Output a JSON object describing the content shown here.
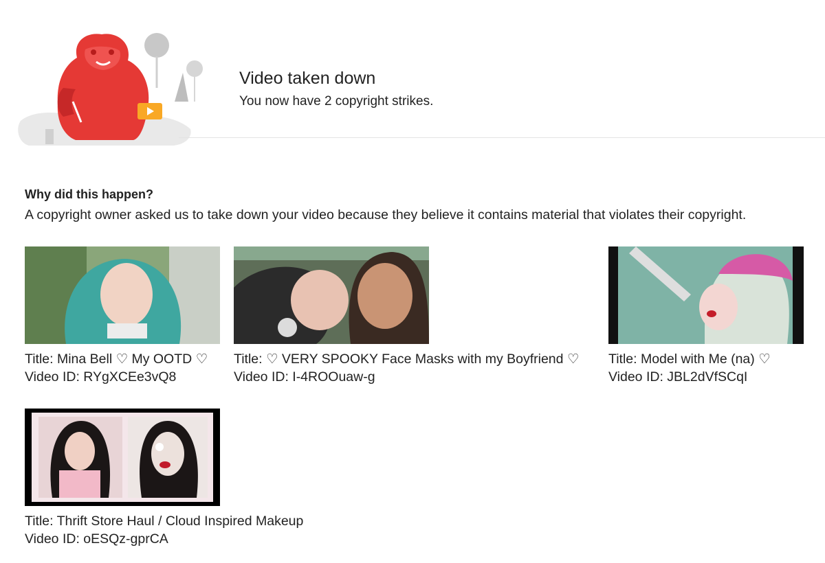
{
  "header": {
    "title": "Video taken down",
    "subtitle": "You now have 2 copyright strikes."
  },
  "reason": {
    "heading": "Why did this happen?",
    "body": "A copyright owner asked us to take down your video because they believe it contains material that violates their copyright."
  },
  "videos": [
    {
      "title": "Title: Mina Bell ♡ My OOTD ♡",
      "id": "Video ID: RYgXCEe3vQ8"
    },
    {
      "title": "Title: ♡ VERY SPOOKY Face Masks with my Boyfriend ♡",
      "id": "Video ID: I-4ROOuaw-g"
    },
    {
      "title": "Title: Model with Me (na) ♡",
      "id": "Video ID: JBL2dVfSCqI"
    },
    {
      "title": "Title: Thrift Store Haul / Cloud Inspired Makeup",
      "id": "Video ID: oESQz-gprCA"
    }
  ],
  "colors": {
    "mascot_red": "#e53935",
    "divider": "#e3e3e3",
    "text": "#222222"
  }
}
